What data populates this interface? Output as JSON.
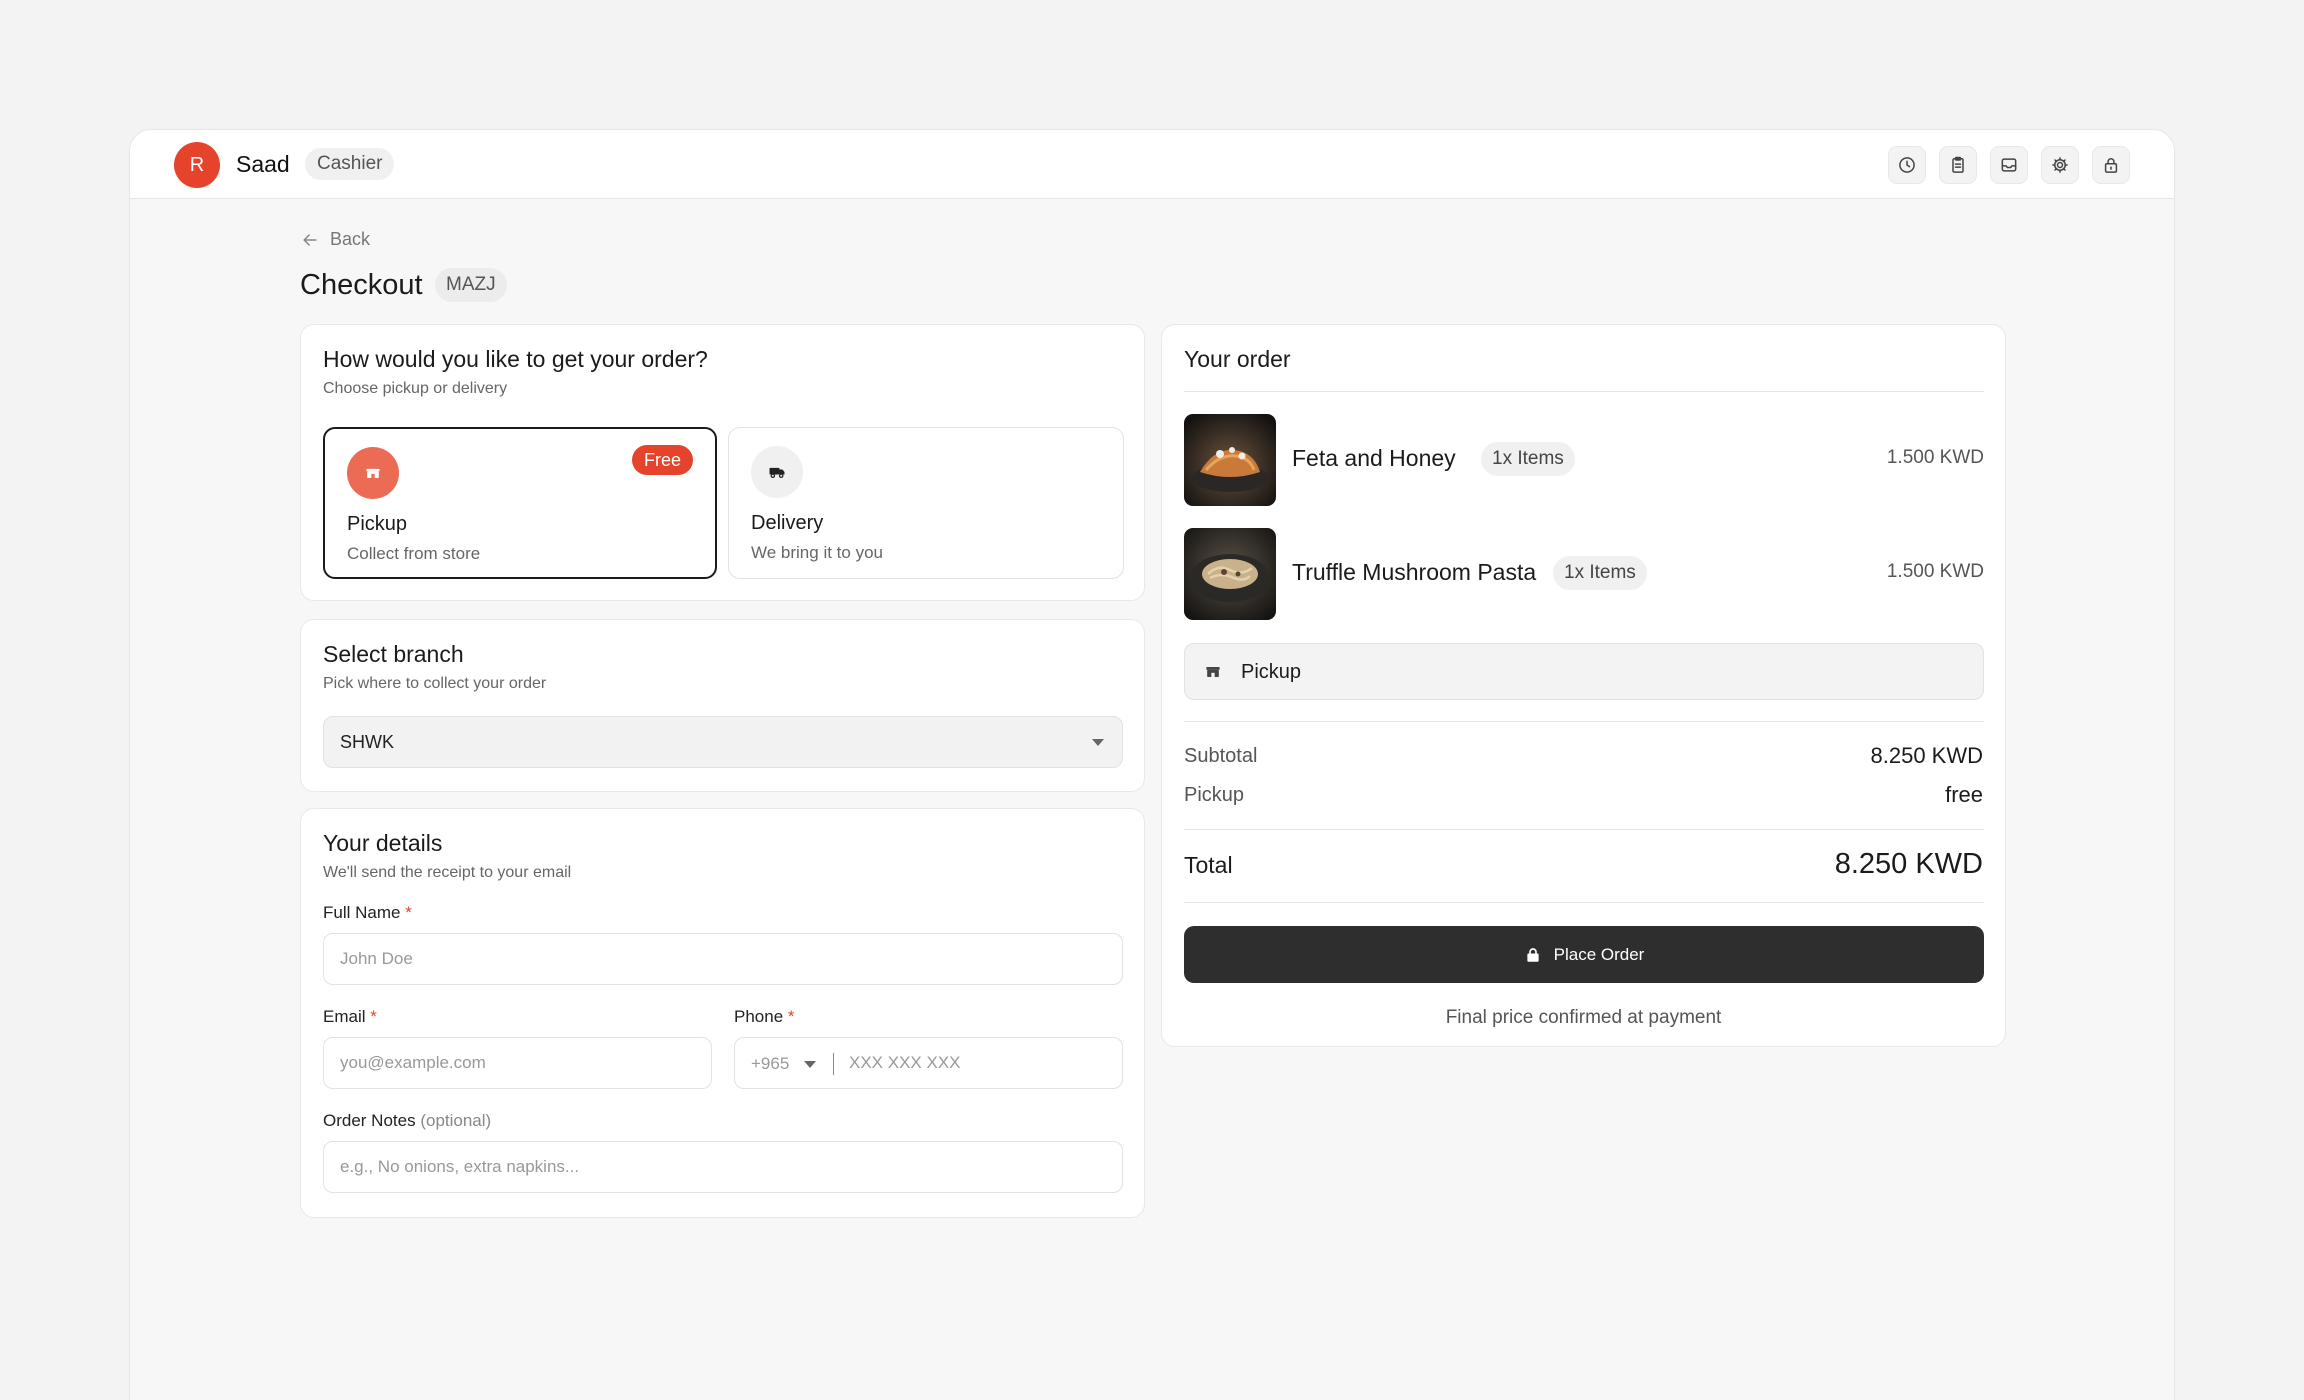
{
  "user": {
    "initial": "R",
    "name": "Saad",
    "role": "Cashier"
  },
  "toolbar": {
    "icons": [
      "clock-icon",
      "clipboard-icon",
      "inbox-icon",
      "gear-icon",
      "lock-icon"
    ]
  },
  "nav": {
    "back_label": "Back"
  },
  "page": {
    "title": "Checkout",
    "store_code": "MAZJ"
  },
  "fulfillment": {
    "title": "How would you like to get your order?",
    "subtitle": "Choose pickup or delivery",
    "options": [
      {
        "label": "Pickup",
        "sub": "Collect from store",
        "badge": "Free",
        "selected": true
      },
      {
        "label": "Delivery",
        "sub": "We bring it to you",
        "selected": false
      }
    ]
  },
  "branch": {
    "title": "Select branch",
    "subtitle": "Pick where to collect your order",
    "selected": "SHWK"
  },
  "details": {
    "title": "Your details",
    "subtitle": "We'll send the receipt to your email",
    "full_name": {
      "label": "Full Name",
      "placeholder": "John Doe",
      "required": "*"
    },
    "email": {
      "label": "Email",
      "placeholder": "you@example.com",
      "required": "*"
    },
    "phone": {
      "label": "Phone",
      "code": "+965",
      "placeholder": "XXX XXX XXX",
      "required": "*"
    },
    "notes": {
      "label": "Order Notes",
      "optional": "(optional)",
      "placeholder": "e.g., No onions, extra napkins..."
    }
  },
  "order": {
    "title": "Your order",
    "items": [
      {
        "name": "Feta and Honey",
        "qty": "1x Items",
        "price": "1.500 KWD"
      },
      {
        "name": "Truffle Mushroom Pasta",
        "qty": "1x Items",
        "price": "1.500 KWD"
      }
    ],
    "method": "Pickup",
    "subtotal_label": "Subtotal",
    "subtotal": "8.250 KWD",
    "pickup_label": "Pickup",
    "pickup_fee": "free",
    "total_label": "Total",
    "total": "8.250 KWD",
    "place_order": "Place Order",
    "note": "Final price confirmed at payment"
  },
  "colors": {
    "accent": "#e5432b",
    "button": "#2e2e2e",
    "background": "#f7f7f7"
  }
}
